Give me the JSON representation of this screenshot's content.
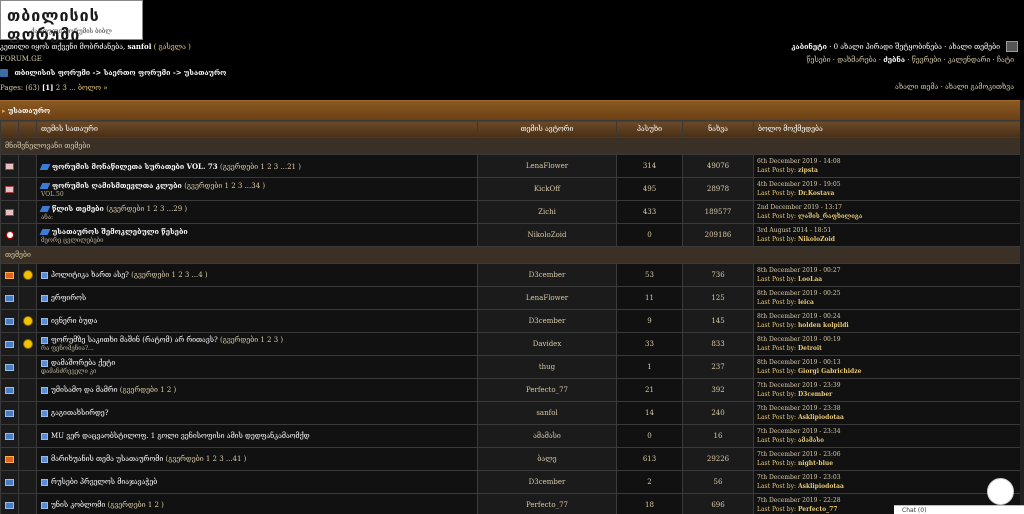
{
  "logo": {
    "title": "თბილისის ფორუმი",
    "subtitle": "ქართული ფორუმის ბიბლ"
  },
  "header": {
    "welcome_prefix": "კეთილი იყოს თქვენი მობრძანება,",
    "username": "sanfol",
    "logout": "( გასვლა )",
    "site_name": "FORUM.GE",
    "cabinet": "კაბინეტი",
    "pm": "· 0 ახალი პირადი შეტყობინება · ახალი თემები",
    "links": "წესები · დახმარება ·",
    "search_bold": "ძებნა",
    "links2": "· წევრები · კალენდარი · ჩატი"
  },
  "breadcrumb": "თბილისის ფორუმი -> საერთო ფორუმი -> უსათაურო",
  "pages": {
    "label": "Pages: (63)",
    "current": "[1]",
    "rest": "2 3 ... ბოლო »"
  },
  "new_links": "ახალი თემა · ახალი გამოკითხვა",
  "category": "უსათაურო",
  "columns": {
    "topic": "თემის სათაური",
    "author": "თემის ავტორი",
    "replies": "პასუხი",
    "views": "ნახვა",
    "last": "ბოლო მოქმედება"
  },
  "sections": {
    "pinned": "მნიშვნელოვანი თემები",
    "normal": "თემები"
  },
  "last_post_label": "Last Post by:",
  "pinned_topics": [
    {
      "title": "ფორუმის მონაწილეთა სურათები VOL. 73",
      "pages": "(გვერდები 1 2 3 ...21 )",
      "sub": "",
      "author": "LenaFlower",
      "replies": "314",
      "views": "49076",
      "date": "6th December 2019 - 14:08",
      "by": "zipsta"
    },
    {
      "title": "ფორუმის ღამისმთევლთა კლუბი",
      "pages": "(გვერდები 1 2 3 ...34 )",
      "sub": "VOL.50",
      "author": "KickOff",
      "replies": "495",
      "views": "28978",
      "date": "4th December 2019 - 19:05",
      "by": "Dr.Kostava"
    },
    {
      "title": "წლის თემები",
      "pages": "(გვერდები 1 2 3 ...29 )",
      "sub": "ანა:",
      "author": "Zichi",
      "replies": "433",
      "views": "189577",
      "date": "2nd December 2019 - 13:17",
      "by": "ლაშის_რაფხილიგა"
    },
    {
      "title": "უსათაუროს შემოკლებული წესები",
      "pages": "",
      "sub": "მეორე ცვლილებები",
      "author": "NikoloZoid",
      "replies": "0",
      "views": "209186",
      "date": "3rd August 2014 - 18:51",
      "by": "NikoloZoid"
    }
  ],
  "topics": [
    {
      "icon": "hot",
      "title": "პოლიტიკა ხართ ასე?",
      "pages": "(გვერდები 1 2 3 ...4 )",
      "sub": "",
      "author": "D3cember",
      "replies": "53",
      "views": "736",
      "date": "8th December 2019 - 00:27",
      "by": "LooLaa",
      "smile": true
    },
    {
      "icon": "env",
      "title": "ერფიროს",
      "pages": "",
      "sub": "",
      "author": "LenaFlower",
      "replies": "11",
      "views": "125",
      "date": "8th December 2019 - 00:25",
      "by": "leica",
      "smile": false
    },
    {
      "icon": "env",
      "title": "ივნერი ბუდა",
      "pages": "",
      "sub": "",
      "author": "D3cember",
      "replies": "9",
      "views": "145",
      "date": "8th December 2019 - 00:24",
      "by": "holden kolpildi",
      "smile": true
    },
    {
      "icon": "env",
      "title": "ფორუმზე საკითხი მაშინ (რატომ) არ რითავს?",
      "pages": "(გვერდები 1 2 3 )",
      "sub": "რა ფენომენია?...",
      "author": "Davidex",
      "replies": "33",
      "views": "833",
      "date": "8th December 2019 - 00:19",
      "by": "Detroit",
      "smile": true
    },
    {
      "icon": "env",
      "title": "დამაშორება ქეტი",
      "pages": "",
      "sub": "დამანძრეველი კი",
      "author": "thug",
      "replies": "1",
      "views": "237",
      "date": "8th December 2019 - 00:13",
      "by": "Giorgi Gabrichidze",
      "smile": false
    },
    {
      "icon": "env",
      "title": "უმისამო და მამრი",
      "pages": "(გვერდები 1 2 )",
      "sub": "",
      "author": "Perfecto_77",
      "replies": "21",
      "views": "392",
      "date": "7th December 2019 - 23:39",
      "by": "D3cember",
      "smile": false
    },
    {
      "icon": "env",
      "title": "გაგითახსირდე?",
      "pages": "",
      "sub": "",
      "author": "sanfol",
      "replies": "14",
      "views": "240",
      "date": "7th December 2019 - 23:38",
      "by": "Asklipiodotaa",
      "smile": false
    },
    {
      "icon": "env",
      "title": "MU ვერ დაცვაობსტილოფ. 1 გოლი ვენისოფისი ამის დედფანკამაომქდ",
      "pages": "",
      "sub": "",
      "author": "ამამასი",
      "replies": "0",
      "views": "16",
      "date": "7th December 2019 - 23:34",
      "by": "ამამასი",
      "smile": false
    },
    {
      "icon": "hot",
      "title": "მარიხუანის თემა უსათაურომი",
      "pages": "(გვერდები 1 2 3 ...41 )",
      "sub": "",
      "author": "ბალე",
      "replies": "613",
      "views": "29226",
      "date": "7th December 2019 - 23:06",
      "by": "night-blue",
      "smile": false
    },
    {
      "icon": "env",
      "title": "რუსები პრველოს მიაჯავაჭებ",
      "pages": "",
      "sub": "",
      "author": "D3cember",
      "replies": "2",
      "views": "56",
      "date": "7th December 2019 - 23:03",
      "by": "Asklipiodotaa",
      "smile": false
    },
    {
      "icon": "env",
      "title": "უნის კობლომი",
      "pages": "(გვერდები 1 2 )",
      "sub": "",
      "author": "Perfecto_77",
      "replies": "18",
      "views": "696",
      "date": "7th December 2019 - 22:28",
      "by": "Perfecto_77",
      "smile": false
    }
  ],
  "chat": "Chat (0)"
}
